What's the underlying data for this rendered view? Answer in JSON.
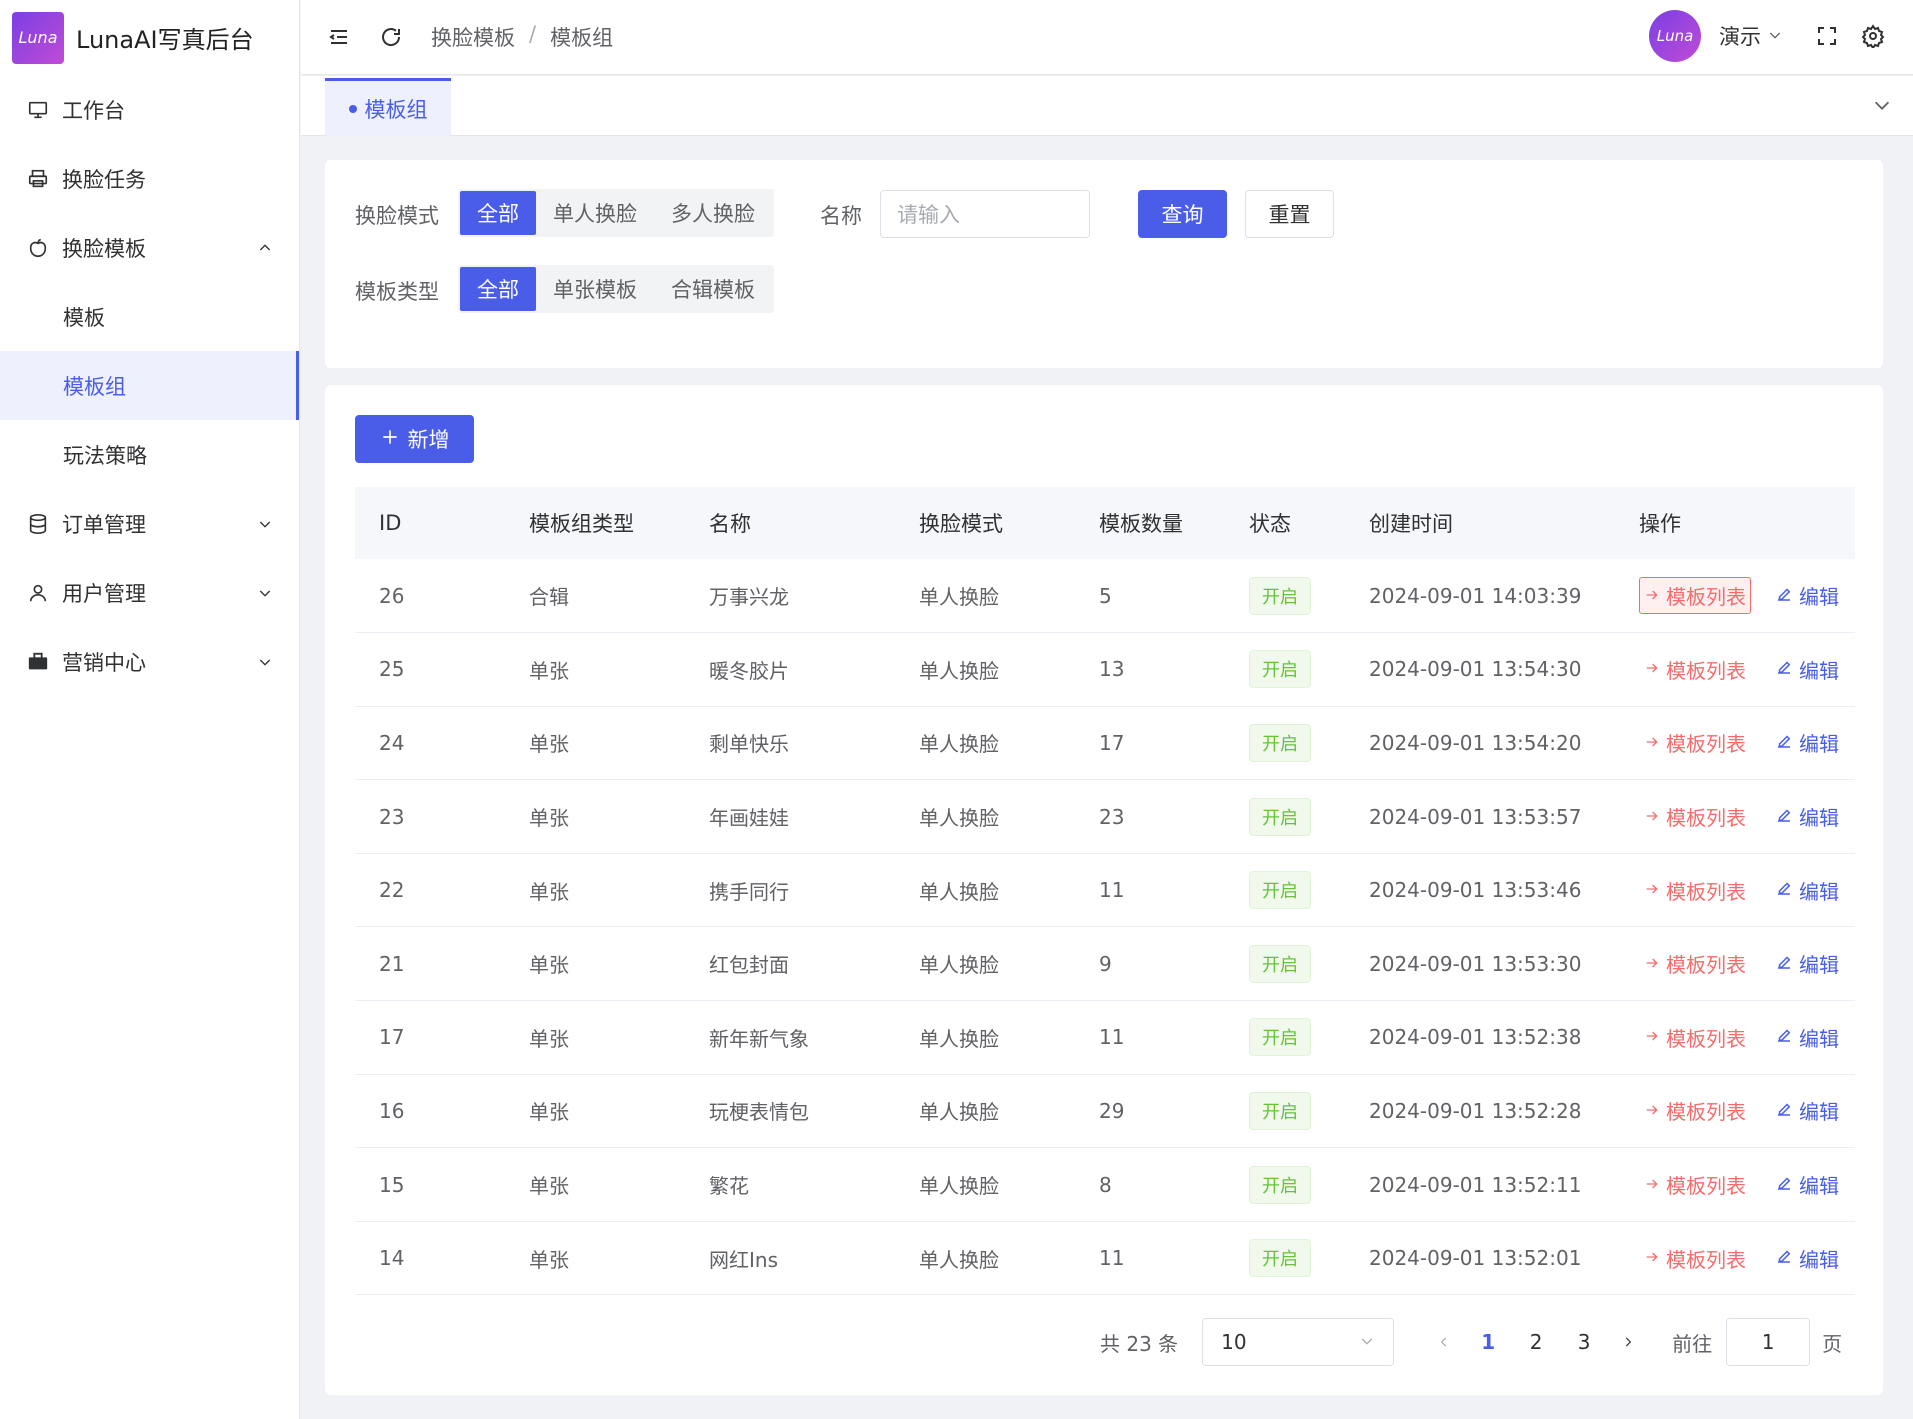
{
  "app": {
    "title": "LunaAI写真后台",
    "logo_text": "Luna"
  },
  "sidebar": {
    "items": [
      {
        "label": "工作台",
        "icon": "monitor-icon"
      },
      {
        "label": "换脸任务",
        "icon": "printer-icon"
      },
      {
        "label": "换脸模板",
        "icon": "apple-icon",
        "expanded": true
      },
      {
        "label": "模板"
      },
      {
        "label": "模板组",
        "active": true
      },
      {
        "label": "玩法策略"
      },
      {
        "label": "订单管理",
        "icon": "database-icon"
      },
      {
        "label": "用户管理",
        "icon": "user-icon"
      },
      {
        "label": "营销中心",
        "icon": "briefcase-icon"
      }
    ]
  },
  "header": {
    "breadcrumb": [
      "换脸模板",
      "模板组"
    ],
    "separator": "/",
    "user": "演示",
    "avatar_text": "Luna"
  },
  "tabs": {
    "active": "模板组"
  },
  "filters": {
    "mode_label": "换脸模式",
    "mode_options": [
      "全部",
      "单人换脸",
      "多人换脸"
    ],
    "type_label": "模板类型",
    "type_options": [
      "全部",
      "单张模板",
      "合辑模板"
    ],
    "name_label": "名称",
    "name_placeholder": "请输入",
    "search_btn": "查询",
    "reset_btn": "重置"
  },
  "toolbar": {
    "add_btn": "新增"
  },
  "table": {
    "headers": [
      "ID",
      "模板组类型",
      "名称",
      "换脸模式",
      "模板数量",
      "状态",
      "创建时间",
      "操作"
    ],
    "op_list": "模板列表",
    "op_edit": "编辑",
    "rows": [
      [
        "26",
        "合辑",
        "万事兴龙",
        "单人换脸",
        "5",
        "开启",
        "2024-09-01 14:03:39"
      ],
      [
        "25",
        "单张",
        "暖冬胶片",
        "单人换脸",
        "13",
        "开启",
        "2024-09-01 13:54:30"
      ],
      [
        "24",
        "单张",
        "剩单快乐",
        "单人换脸",
        "17",
        "开启",
        "2024-09-01 13:54:20"
      ],
      [
        "23",
        "单张",
        "年画娃娃",
        "单人换脸",
        "23",
        "开启",
        "2024-09-01 13:53:57"
      ],
      [
        "22",
        "单张",
        "携手同行",
        "单人换脸",
        "11",
        "开启",
        "2024-09-01 13:53:46"
      ],
      [
        "21",
        "单张",
        "红包封面",
        "单人换脸",
        "9",
        "开启",
        "2024-09-01 13:53:30"
      ],
      [
        "17",
        "单张",
        "新年新气象",
        "单人换脸",
        "11",
        "开启",
        "2024-09-01 13:52:38"
      ],
      [
        "16",
        "单张",
        "玩梗表情包",
        "单人换脸",
        "29",
        "开启",
        "2024-09-01 13:52:28"
      ],
      [
        "15",
        "单张",
        "繁花",
        "单人换脸",
        "8",
        "开启",
        "2024-09-01 13:52:11"
      ],
      [
        "14",
        "单张",
        "网红Ins",
        "单人换脸",
        "11",
        "开启",
        "2024-09-01 13:52:01"
      ]
    ]
  },
  "pagination": {
    "total_text": "共 23 条",
    "page_size": "10",
    "pages": [
      "1",
      "2",
      "3"
    ],
    "current": "1",
    "goto_label": "前往",
    "goto_value": "1",
    "page_suffix": "页"
  },
  "colors": {
    "primary": "#4a5de8",
    "danger": "#f56c6c",
    "success": "#67c23a"
  }
}
